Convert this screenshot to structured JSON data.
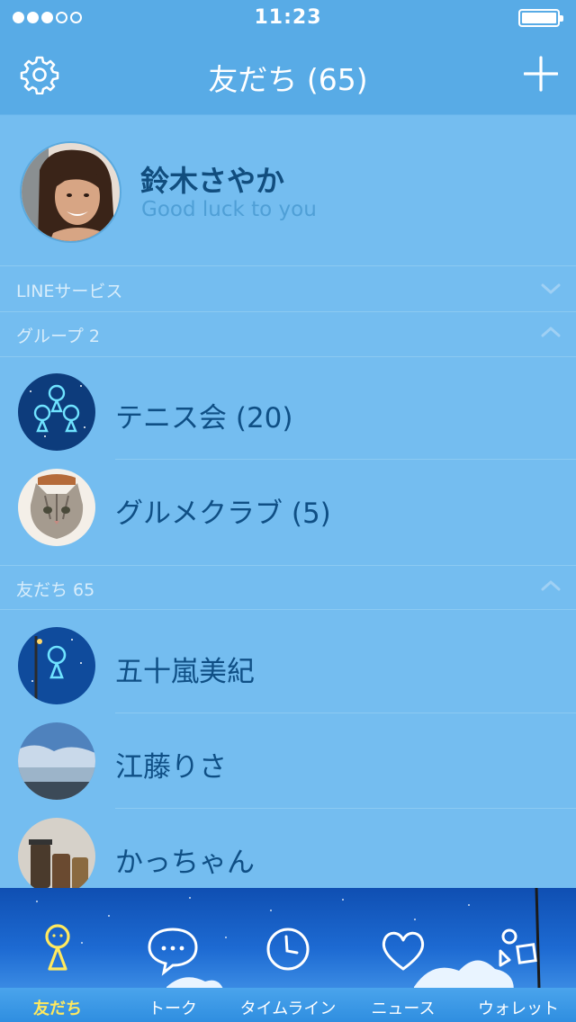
{
  "status_bar": {
    "time": "11:23",
    "signal_strength": 3,
    "signal_max": 5,
    "battery_level": 1.0
  },
  "header": {
    "title": "友だち (65)",
    "left_icon": "gear-icon",
    "right_icon": "plus-icon"
  },
  "profile": {
    "name": "鈴木さやか",
    "status": "Good luck to you"
  },
  "sections": {
    "line_services": {
      "label": "LINEサービス",
      "expanded": false
    },
    "groups": {
      "label": "グループ 2",
      "expanded": true
    },
    "friends": {
      "label": "友だち 65",
      "expanded": true
    }
  },
  "groups": [
    {
      "name": "テニス会 (20)",
      "avatar": "glowing-figures"
    },
    {
      "name": "グルメクラブ (5)",
      "avatar": "cat"
    }
  ],
  "friends": [
    {
      "name": "五十嵐美紀",
      "avatar": "night-figure"
    },
    {
      "name": "江藤りさ",
      "avatar": "sky"
    },
    {
      "name": "かっちゃん",
      "avatar": "jars"
    }
  ],
  "tabs": [
    {
      "label": "友だち",
      "icon": "friends-icon",
      "active": true
    },
    {
      "label": "トーク",
      "icon": "chat-bubble-icon",
      "active": false
    },
    {
      "label": "タイムライン",
      "icon": "clock-icon",
      "active": false
    },
    {
      "label": "ニュース",
      "icon": "heart-icon",
      "active": false
    },
    {
      "label": "ウォレット",
      "icon": "wallet-shapes-icon",
      "active": false
    }
  ],
  "colors": {
    "background": "#74bdf0",
    "header": "#58abe6",
    "text_dark": "#0f4f85",
    "active_tab": "#ffe95e"
  }
}
